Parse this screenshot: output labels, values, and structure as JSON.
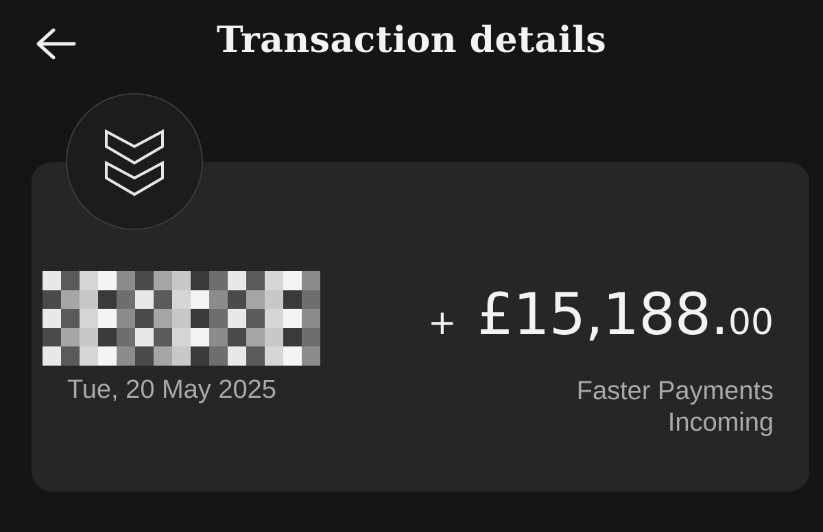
{
  "header": {
    "title": "Transaction details",
    "back_icon": "arrow-left-icon"
  },
  "transaction": {
    "icon": "double-chevron-down-icon",
    "date": "Tue, 20 May 2025",
    "amount_sign": "+",
    "amount_main": "£15,188.",
    "amount_pence": "00",
    "method_line1": "Faster Payments",
    "method_line2": "Incoming"
  },
  "colors": {
    "background": "#151516",
    "card": "#262627",
    "text_primary": "#f3f3f3",
    "text_secondary": "#a9a9ab"
  }
}
